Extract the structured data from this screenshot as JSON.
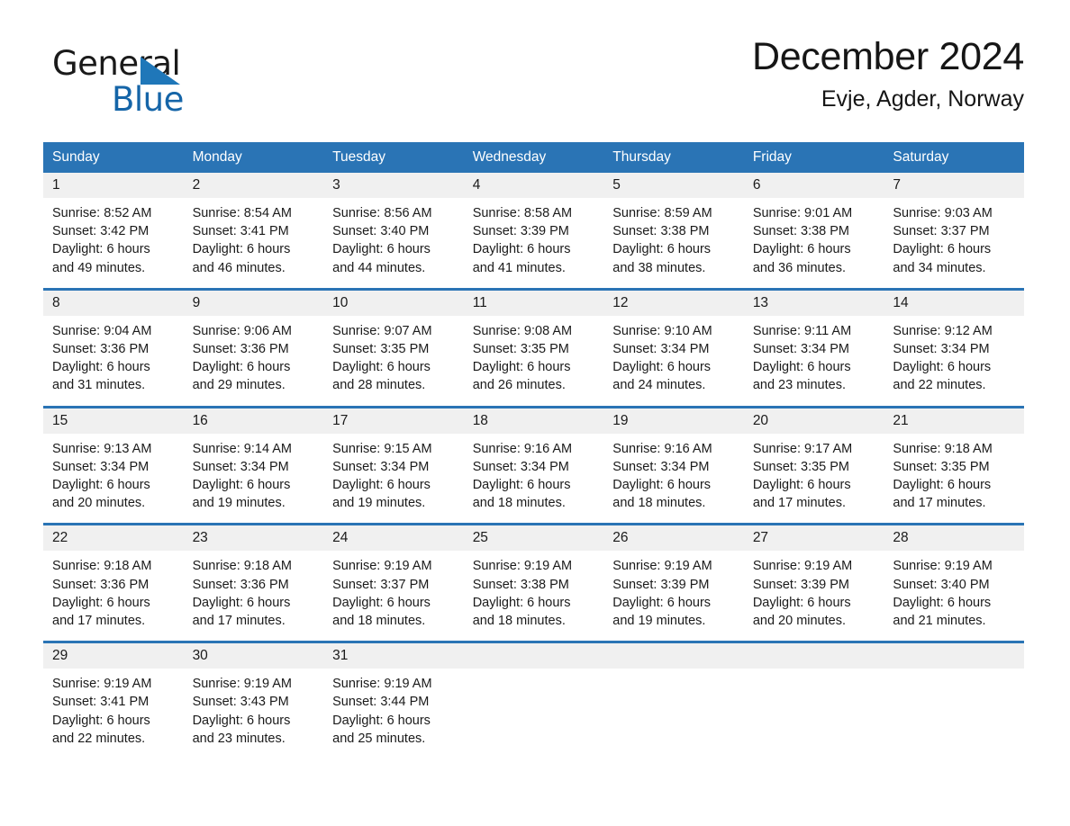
{
  "brand": {
    "name_part1": "General",
    "name_part2": "Blue",
    "triangle_color": "#1f77b9",
    "blue_text_color": "#1565a8"
  },
  "header": {
    "title": "December 2024",
    "subtitle": "Evje, Agder, Norway"
  },
  "theme": {
    "header_blue": "#2a74b5",
    "daynum_band": "#f0f0f0",
    "text": "#1a1a1a"
  },
  "weekday_headers": [
    "Sunday",
    "Monday",
    "Tuesday",
    "Wednesday",
    "Thursday",
    "Friday",
    "Saturday"
  ],
  "weeks": [
    [
      {
        "day": "1",
        "sunrise": "Sunrise: 8:52 AM",
        "sunset": "Sunset: 3:42 PM",
        "daylight_line1": "Daylight: 6 hours",
        "daylight_line2": "and 49 minutes."
      },
      {
        "day": "2",
        "sunrise": "Sunrise: 8:54 AM",
        "sunset": "Sunset: 3:41 PM",
        "daylight_line1": "Daylight: 6 hours",
        "daylight_line2": "and 46 minutes."
      },
      {
        "day": "3",
        "sunrise": "Sunrise: 8:56 AM",
        "sunset": "Sunset: 3:40 PM",
        "daylight_line1": "Daylight: 6 hours",
        "daylight_line2": "and 44 minutes."
      },
      {
        "day": "4",
        "sunrise": "Sunrise: 8:58 AM",
        "sunset": "Sunset: 3:39 PM",
        "daylight_line1": "Daylight: 6 hours",
        "daylight_line2": "and 41 minutes."
      },
      {
        "day": "5",
        "sunrise": "Sunrise: 8:59 AM",
        "sunset": "Sunset: 3:38 PM",
        "daylight_line1": "Daylight: 6 hours",
        "daylight_line2": "and 38 minutes."
      },
      {
        "day": "6",
        "sunrise": "Sunrise: 9:01 AM",
        "sunset": "Sunset: 3:38 PM",
        "daylight_line1": "Daylight: 6 hours",
        "daylight_line2": "and 36 minutes."
      },
      {
        "day": "7",
        "sunrise": "Sunrise: 9:03 AM",
        "sunset": "Sunset: 3:37 PM",
        "daylight_line1": "Daylight: 6 hours",
        "daylight_line2": "and 34 minutes."
      }
    ],
    [
      {
        "day": "8",
        "sunrise": "Sunrise: 9:04 AM",
        "sunset": "Sunset: 3:36 PM",
        "daylight_line1": "Daylight: 6 hours",
        "daylight_line2": "and 31 minutes."
      },
      {
        "day": "9",
        "sunrise": "Sunrise: 9:06 AM",
        "sunset": "Sunset: 3:36 PM",
        "daylight_line1": "Daylight: 6 hours",
        "daylight_line2": "and 29 minutes."
      },
      {
        "day": "10",
        "sunrise": "Sunrise: 9:07 AM",
        "sunset": "Sunset: 3:35 PM",
        "daylight_line1": "Daylight: 6 hours",
        "daylight_line2": "and 28 minutes."
      },
      {
        "day": "11",
        "sunrise": "Sunrise: 9:08 AM",
        "sunset": "Sunset: 3:35 PM",
        "daylight_line1": "Daylight: 6 hours",
        "daylight_line2": "and 26 minutes."
      },
      {
        "day": "12",
        "sunrise": "Sunrise: 9:10 AM",
        "sunset": "Sunset: 3:34 PM",
        "daylight_line1": "Daylight: 6 hours",
        "daylight_line2": "and 24 minutes."
      },
      {
        "day": "13",
        "sunrise": "Sunrise: 9:11 AM",
        "sunset": "Sunset: 3:34 PM",
        "daylight_line1": "Daylight: 6 hours",
        "daylight_line2": "and 23 minutes."
      },
      {
        "day": "14",
        "sunrise": "Sunrise: 9:12 AM",
        "sunset": "Sunset: 3:34 PM",
        "daylight_line1": "Daylight: 6 hours",
        "daylight_line2": "and 22 minutes."
      }
    ],
    [
      {
        "day": "15",
        "sunrise": "Sunrise: 9:13 AM",
        "sunset": "Sunset: 3:34 PM",
        "daylight_line1": "Daylight: 6 hours",
        "daylight_line2": "and 20 minutes."
      },
      {
        "day": "16",
        "sunrise": "Sunrise: 9:14 AM",
        "sunset": "Sunset: 3:34 PM",
        "daylight_line1": "Daylight: 6 hours",
        "daylight_line2": "and 19 minutes."
      },
      {
        "day": "17",
        "sunrise": "Sunrise: 9:15 AM",
        "sunset": "Sunset: 3:34 PM",
        "daylight_line1": "Daylight: 6 hours",
        "daylight_line2": "and 19 minutes."
      },
      {
        "day": "18",
        "sunrise": "Sunrise: 9:16 AM",
        "sunset": "Sunset: 3:34 PM",
        "daylight_line1": "Daylight: 6 hours",
        "daylight_line2": "and 18 minutes."
      },
      {
        "day": "19",
        "sunrise": "Sunrise: 9:16 AM",
        "sunset": "Sunset: 3:34 PM",
        "daylight_line1": "Daylight: 6 hours",
        "daylight_line2": "and 18 minutes."
      },
      {
        "day": "20",
        "sunrise": "Sunrise: 9:17 AM",
        "sunset": "Sunset: 3:35 PM",
        "daylight_line1": "Daylight: 6 hours",
        "daylight_line2": "and 17 minutes."
      },
      {
        "day": "21",
        "sunrise": "Sunrise: 9:18 AM",
        "sunset": "Sunset: 3:35 PM",
        "daylight_line1": "Daylight: 6 hours",
        "daylight_line2": "and 17 minutes."
      }
    ],
    [
      {
        "day": "22",
        "sunrise": "Sunrise: 9:18 AM",
        "sunset": "Sunset: 3:36 PM",
        "daylight_line1": "Daylight: 6 hours",
        "daylight_line2": "and 17 minutes."
      },
      {
        "day": "23",
        "sunrise": "Sunrise: 9:18 AM",
        "sunset": "Sunset: 3:36 PM",
        "daylight_line1": "Daylight: 6 hours",
        "daylight_line2": "and 17 minutes."
      },
      {
        "day": "24",
        "sunrise": "Sunrise: 9:19 AM",
        "sunset": "Sunset: 3:37 PM",
        "daylight_line1": "Daylight: 6 hours",
        "daylight_line2": "and 18 minutes."
      },
      {
        "day": "25",
        "sunrise": "Sunrise: 9:19 AM",
        "sunset": "Sunset: 3:38 PM",
        "daylight_line1": "Daylight: 6 hours",
        "daylight_line2": "and 18 minutes."
      },
      {
        "day": "26",
        "sunrise": "Sunrise: 9:19 AM",
        "sunset": "Sunset: 3:39 PM",
        "daylight_line1": "Daylight: 6 hours",
        "daylight_line2": "and 19 minutes."
      },
      {
        "day": "27",
        "sunrise": "Sunrise: 9:19 AM",
        "sunset": "Sunset: 3:39 PM",
        "daylight_line1": "Daylight: 6 hours",
        "daylight_line2": "and 20 minutes."
      },
      {
        "day": "28",
        "sunrise": "Sunrise: 9:19 AM",
        "sunset": "Sunset: 3:40 PM",
        "daylight_line1": "Daylight: 6 hours",
        "daylight_line2": "and 21 minutes."
      }
    ],
    [
      {
        "day": "29",
        "sunrise": "Sunrise: 9:19 AM",
        "sunset": "Sunset: 3:41 PM",
        "daylight_line1": "Daylight: 6 hours",
        "daylight_line2": "and 22 minutes."
      },
      {
        "day": "30",
        "sunrise": "Sunrise: 9:19 AM",
        "sunset": "Sunset: 3:43 PM",
        "daylight_line1": "Daylight: 6 hours",
        "daylight_line2": "and 23 minutes."
      },
      {
        "day": "31",
        "sunrise": "Sunrise: 9:19 AM",
        "sunset": "Sunset: 3:44 PM",
        "daylight_line1": "Daylight: 6 hours",
        "daylight_line2": "and 25 minutes."
      },
      {
        "day": "",
        "sunrise": "",
        "sunset": "",
        "daylight_line1": "",
        "daylight_line2": ""
      },
      {
        "day": "",
        "sunrise": "",
        "sunset": "",
        "daylight_line1": "",
        "daylight_line2": ""
      },
      {
        "day": "",
        "sunrise": "",
        "sunset": "",
        "daylight_line1": "",
        "daylight_line2": ""
      },
      {
        "day": "",
        "sunrise": "",
        "sunset": "",
        "daylight_line1": "",
        "daylight_line2": ""
      }
    ]
  ]
}
